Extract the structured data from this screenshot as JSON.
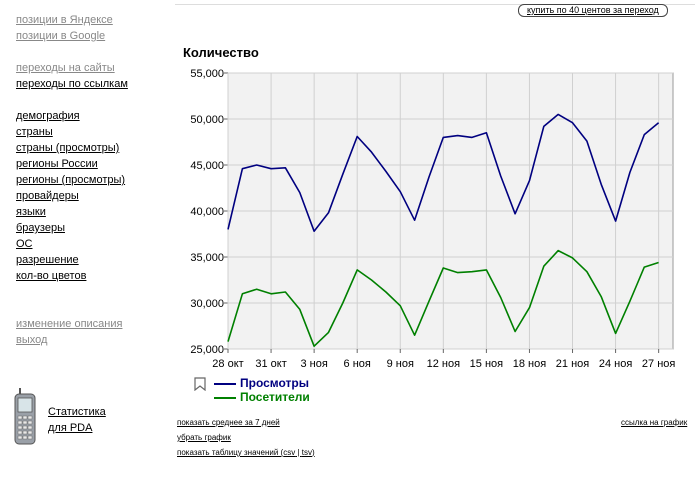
{
  "sidebar": {
    "group1": [
      "позиции в Яндексе",
      "позиции в Google"
    ],
    "group2": [
      {
        "label": "переходы на сайты",
        "active": false
      },
      {
        "label": "переходы по ссылкам",
        "active": true
      }
    ],
    "group3": [
      "демография",
      "страны",
      "страны (просмотры)",
      "регионы России",
      "регионы (просмотры)",
      "провайдеры",
      "языки",
      "браузеры",
      "ОС",
      "разрешение",
      "кол-во цветов"
    ],
    "group4": [
      "изменение описания",
      "выход"
    ],
    "pda": {
      "line1": "Статистика",
      "line2": "для PDA",
      "icon": "pda-phone-icon"
    }
  },
  "header": {
    "buy_label": "купить по 40 центов за переход"
  },
  "chart_data": {
    "type": "line",
    "title": "Количество",
    "x": [
      "28 окт",
      "29 окт",
      "30 окт",
      "31 окт",
      "1 ноя",
      "2 ноя",
      "3 ноя",
      "4 ноя",
      "5 ноя",
      "6 ноя",
      "7 ноя",
      "8 ноя",
      "9 ноя",
      "10 ноя",
      "11 ноя",
      "12 ноя",
      "13 ноя",
      "14 ноя",
      "15 ноя",
      "16 ноя",
      "17 ноя",
      "18 ноя",
      "19 ноя",
      "20 ноя",
      "21 ноя",
      "22 ноя",
      "23 ноя",
      "24 ноя",
      "25 ноя",
      "26 ноя",
      "27 ноя",
      "28 ноя"
    ],
    "x_tick_labels": [
      "28 окт",
      "31 окт",
      "3 ноя",
      "6 ноя",
      "9 ноя",
      "12 ноя",
      "15 ноя",
      "18 ноя",
      "21 ноя",
      "24 ноя",
      "27 ноя"
    ],
    "ylim": [
      25000,
      55000
    ],
    "y_ticks": [
      "25,000",
      "30,000",
      "35,000",
      "40,000",
      "45,000",
      "50,000",
      "55,000"
    ],
    "grid": true,
    "series": [
      {
        "name": "Просмотры",
        "color": "#000080",
        "values": [
          38000,
          44600,
          45000,
          44600,
          44700,
          42000,
          37800,
          39800,
          44000,
          48100,
          46400,
          44300,
          42100,
          39000,
          43700,
          48000,
          48200,
          48000,
          48500,
          43800,
          39700,
          43300,
          49200,
          50500,
          49600,
          47600,
          42900,
          38900,
          44200,
          48300,
          49600,
          null
        ]
      },
      {
        "name": "Посетители",
        "color": "#008000",
        "values": [
          25800,
          31000,
          31500,
          31000,
          31200,
          29300,
          25300,
          26800,
          30000,
          33600,
          32500,
          31200,
          29700,
          26500,
          30200,
          33800,
          33300,
          33400,
          33600,
          30600,
          26900,
          29500,
          34000,
          35700,
          34900,
          33400,
          30700,
          26700,
          30200,
          33900,
          34400,
          null
        ]
      }
    ]
  },
  "bottom": {
    "avg7": "показать среднее за 7 дней",
    "remove": "убрать график",
    "table_prefix": "показать таблицу значений (",
    "csv": "csv",
    "sep": " | ",
    "tsv": "tsv",
    "table_suffix": ")",
    "chart_link": "ссылка на график"
  }
}
